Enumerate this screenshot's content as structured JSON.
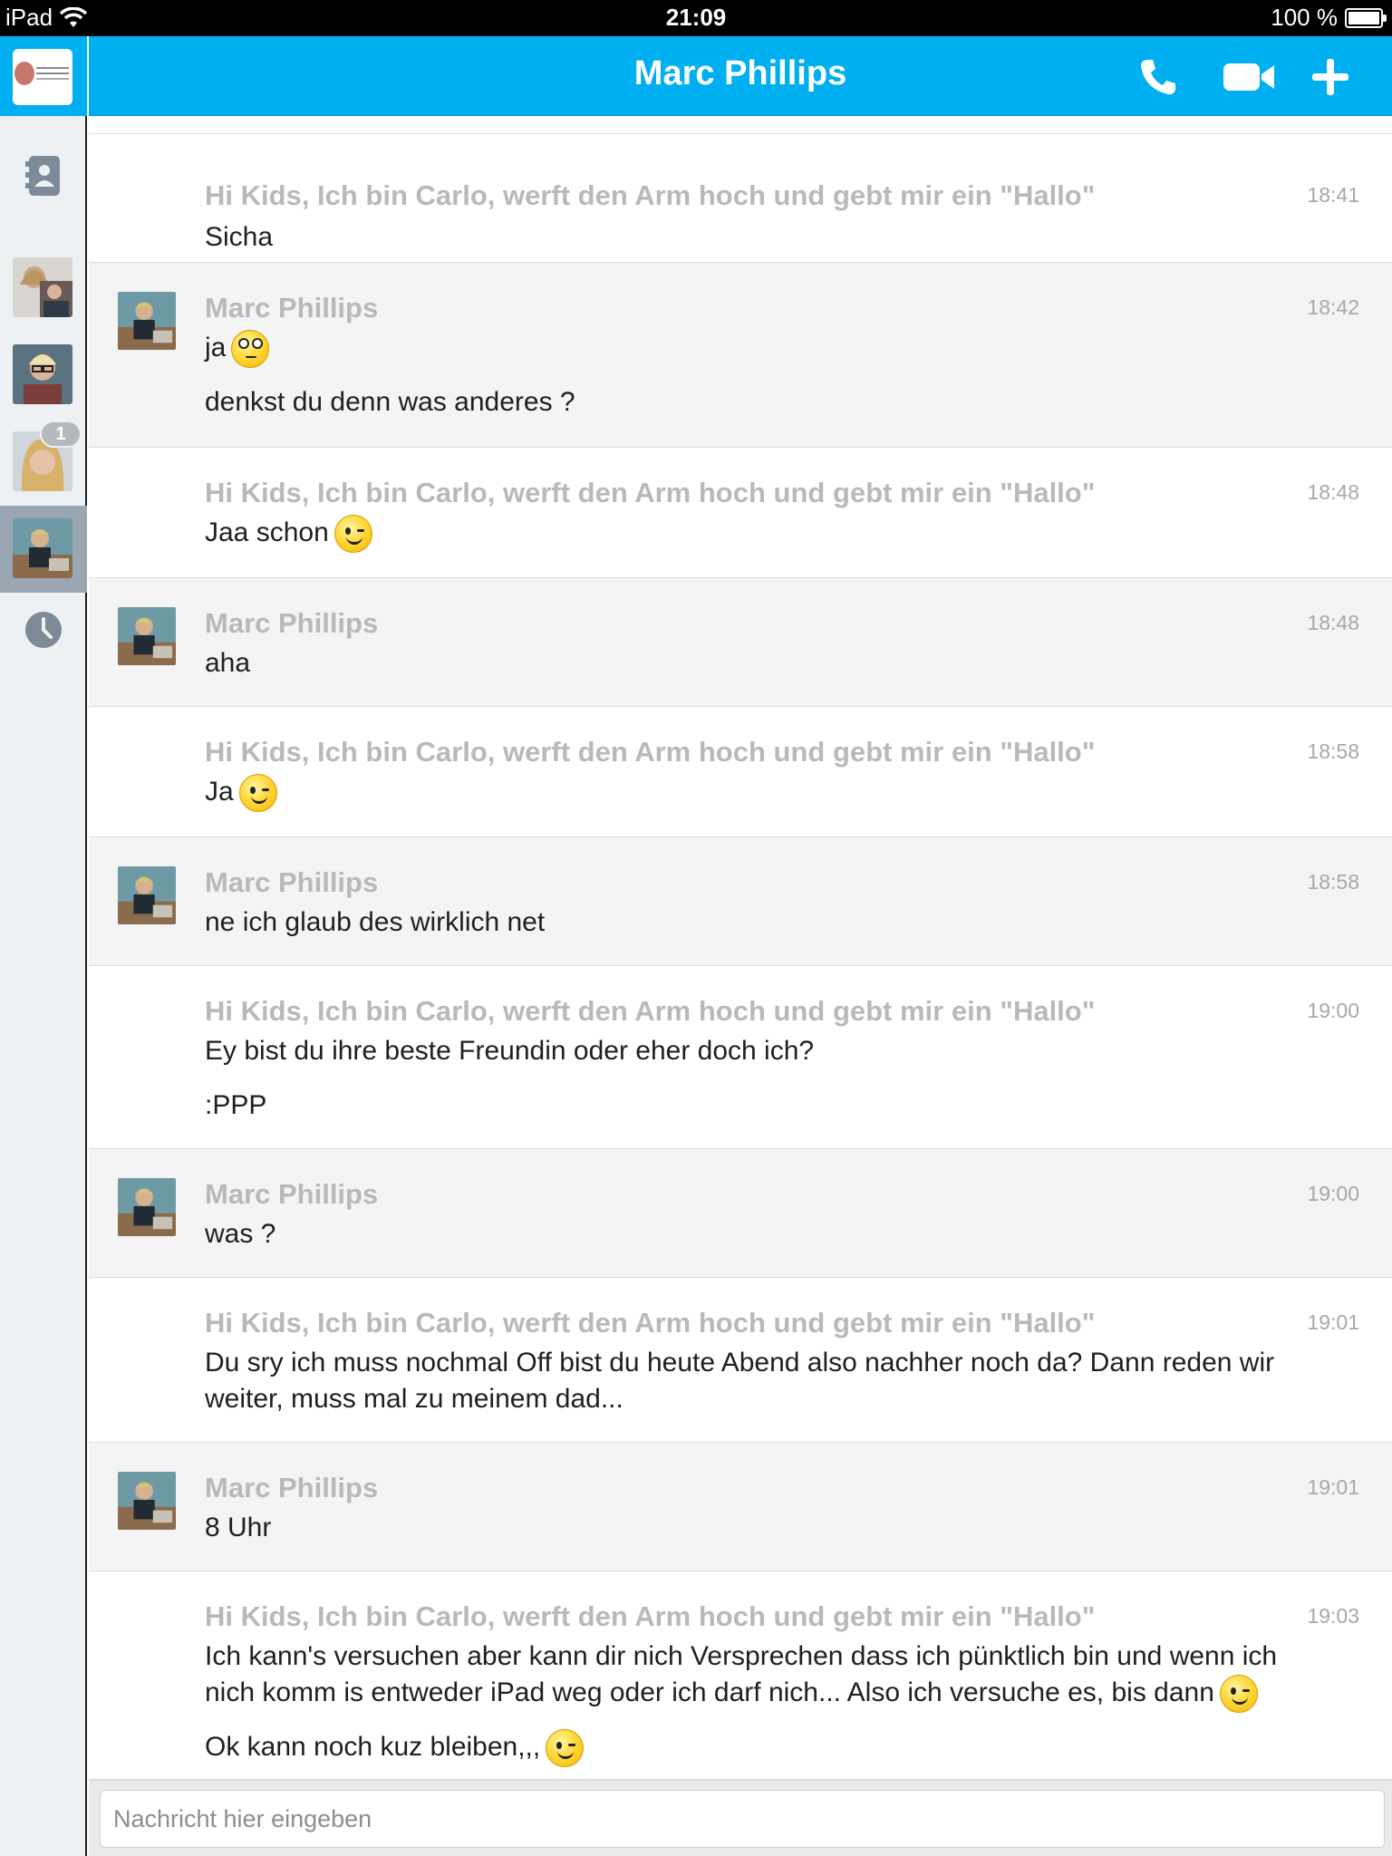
{
  "status_bar": {
    "device": "iPad",
    "time": "21:09",
    "battery": "100 %",
    "battery_level": 1.0
  },
  "header": {
    "title": "Marc Phillips",
    "icons": [
      "phone-icon",
      "video-camera-icon",
      "plus-icon"
    ]
  },
  "sidebar": {
    "icons": [
      "contacts-icon",
      "recent-clock-icon"
    ],
    "contacts": [
      {
        "name": "contact-1",
        "unread": ""
      },
      {
        "name": "contact-2",
        "unread": ""
      },
      {
        "name": "contact-3",
        "unread": "1"
      },
      {
        "name": "contact-4",
        "unread": "",
        "selected": true
      }
    ]
  },
  "messages": [
    {
      "type": "self",
      "sender": "Hi Kids, Ich bin Carlo, werft den Arm hoch und gebt mir ein \"Hallo\"",
      "time": "18:41",
      "lines": [
        "Sicha"
      ]
    },
    {
      "type": "other",
      "sender": "Marc Phillips",
      "time": "18:42",
      "lines": [
        "ja",
        "denkst du denn was anderes ?"
      ]
    },
    {
      "type": "self",
      "sender": "Hi Kids, Ich bin Carlo, werft den Arm hoch und gebt mir ein \"Hallo\"",
      "time": "18:48",
      "lines": [
        "Jaa schon"
      ]
    },
    {
      "type": "other",
      "sender": "Marc Phillips",
      "time": "18:48",
      "lines": [
        "aha"
      ]
    },
    {
      "type": "self",
      "sender": "Hi Kids, Ich bin Carlo, werft den Arm hoch und gebt mir ein \"Hallo\"",
      "time": "18:58",
      "lines": [
        "Ja"
      ]
    },
    {
      "type": "other",
      "sender": "Marc Phillips",
      "time": "18:58",
      "lines": [
        "ne ich glaub des wirklich net"
      ]
    },
    {
      "type": "self",
      "sender": "Hi Kids, Ich bin Carlo, werft den Arm hoch und gebt mir ein \"Hallo\"",
      "time": "19:00",
      "lines": [
        "Ey bist du ihre beste Freundin oder eher doch ich?",
        ":PPP"
      ]
    },
    {
      "type": "other",
      "sender": "Marc Phillips",
      "time": "19:00",
      "lines": [
        "was ?"
      ]
    },
    {
      "type": "self",
      "sender": "Hi Kids, Ich bin Carlo, werft den Arm hoch und gebt mir ein \"Hallo\"",
      "time": "19:01",
      "lines": [
        "Du sry ich muss nochmal Off bist du heute Abend also nachher noch da? Dann reden wir",
        "weiter, muss mal zu meinem dad..."
      ]
    },
    {
      "type": "other",
      "sender": "Marc Phillips",
      "time": "19:01",
      "lines": [
        "8 Uhr"
      ]
    },
    {
      "type": "self",
      "sender": "Hi Kids, Ich bin Carlo, werft den Arm hoch und gebt mir ein \"Hallo\"",
      "time": "19:03",
      "lines": [
        "Ich kann's versuchen aber kann dir nich Versprechen dass ich pünktlich bin und wenn ich",
        "nich komm is entweder iPad weg oder ich darf nich... Also ich versuche es, bis dann",
        "Ok kann noch kuz bleiben,,,"
      ]
    }
  ],
  "composer": {
    "placeholder": "Nachricht hier eingeben",
    "value": ""
  }
}
